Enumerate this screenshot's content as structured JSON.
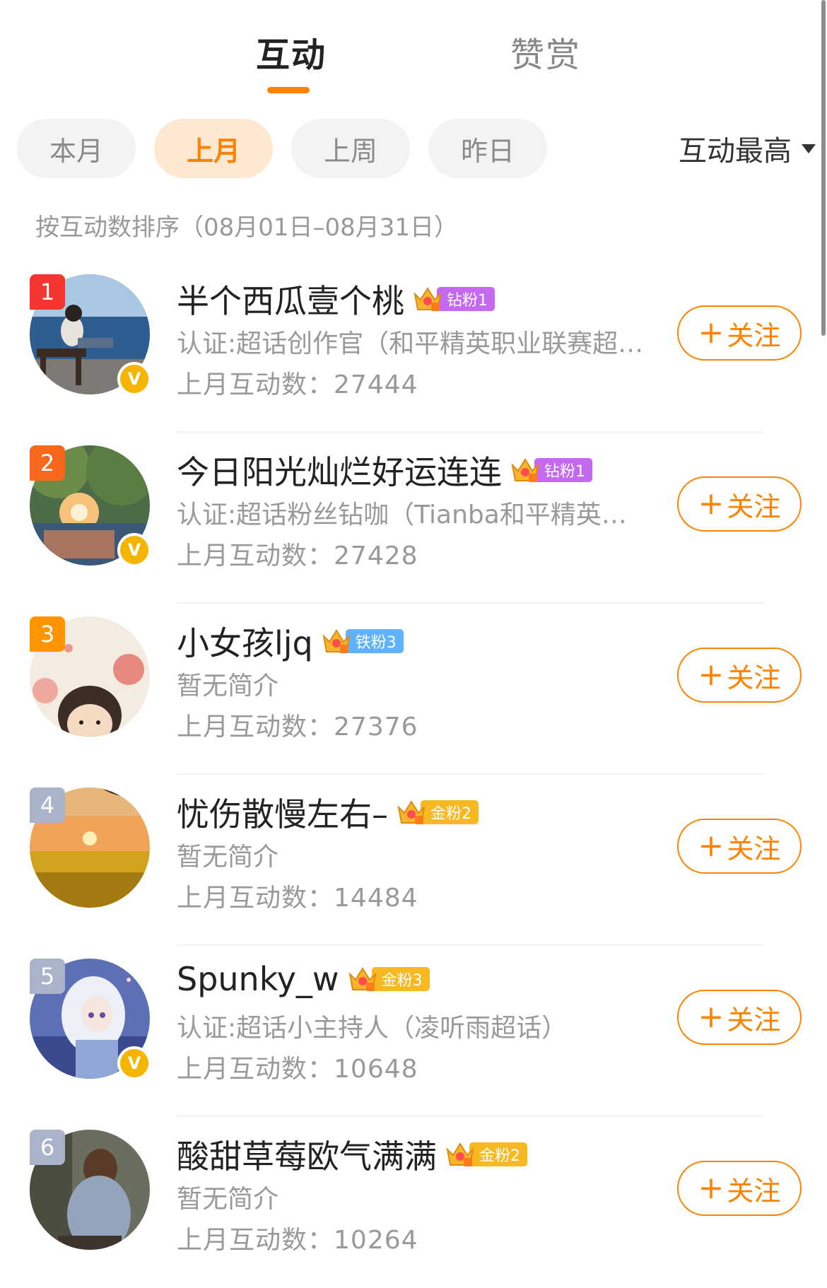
{
  "tabs": [
    {
      "label": "互动",
      "active": true
    },
    {
      "label": "赞赏",
      "active": false
    }
  ],
  "filters": [
    {
      "label": "本月",
      "active": false
    },
    {
      "label": "上月",
      "active": true
    },
    {
      "label": "上周",
      "active": false
    },
    {
      "label": "昨日",
      "active": false
    }
  ],
  "sort": {
    "label": "互动最高",
    "icon": "caret-down-icon"
  },
  "caption": "按互动数排序（08月01日–08月31日）",
  "count_prefix": "上月互动数：",
  "follow_label": "关注",
  "colors": {
    "accent": "#ff8200",
    "rank1": "#f43530",
    "rank2": "#f7671d",
    "rank3": "#ff9500",
    "rank_other": "#a9b3c9",
    "badge_diamond": "#c468f0",
    "badge_iron": "#5fb2ff",
    "badge_gold": "#f8b822",
    "verified": "#f5b400"
  },
  "users": [
    {
      "rank": "1",
      "name": "半个西瓜壹个桃",
      "badge": "钻粉1",
      "badge_type": "diamond",
      "desc": "认证:超话创作官（和平精英职业联赛超话）",
      "count": "27444",
      "verified": true
    },
    {
      "rank": "2",
      "name": "今日阳光灿烂好运连连",
      "badge": "钻粉1",
      "badge_type": "diamond",
      "desc": "认证:超话粉丝钻咖（Tianba和平精英超话）",
      "count": "27428",
      "verified": true
    },
    {
      "rank": "3",
      "name": "小女孩ljq",
      "badge": "铁粉3",
      "badge_type": "iron",
      "desc": "暂无简介",
      "count": "27376",
      "verified": false
    },
    {
      "rank": "4",
      "name": "忧伤散慢左右–",
      "badge": "金粉2",
      "badge_type": "gold",
      "desc": "暂无简介",
      "count": "14484",
      "verified": false
    },
    {
      "rank": "5",
      "name": "Spunky_w",
      "badge": "金粉3",
      "badge_type": "gold",
      "desc": "认证:超话小主持人（凌听雨超话）",
      "count": "10648",
      "verified": true
    },
    {
      "rank": "6",
      "name": "酸甜草莓欧气满满",
      "badge": "金粉2",
      "badge_type": "gold",
      "desc": "暂无简介",
      "count": "10264",
      "verified": false
    }
  ]
}
